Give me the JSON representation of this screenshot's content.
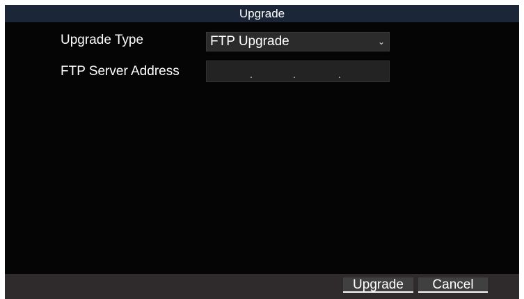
{
  "dialog": {
    "title": "Upgrade"
  },
  "form": {
    "upgrade_type_label": "Upgrade Type",
    "upgrade_type_value": "FTP Upgrade",
    "ftp_server_label": "FTP Server Address",
    "ftp_server_octet_separators": [
      ".",
      ".",
      "."
    ]
  },
  "footer": {
    "upgrade_label": "Upgrade",
    "cancel_label": "Cancel"
  },
  "colors": {
    "background": "#050505",
    "title_bar": "#1b2638",
    "footer_bar": "#2f2a2b",
    "input_background": "#2b2b2b",
    "button_background": "#404040"
  },
  "icons": {
    "dropdown": "chevron-down-icon"
  }
}
